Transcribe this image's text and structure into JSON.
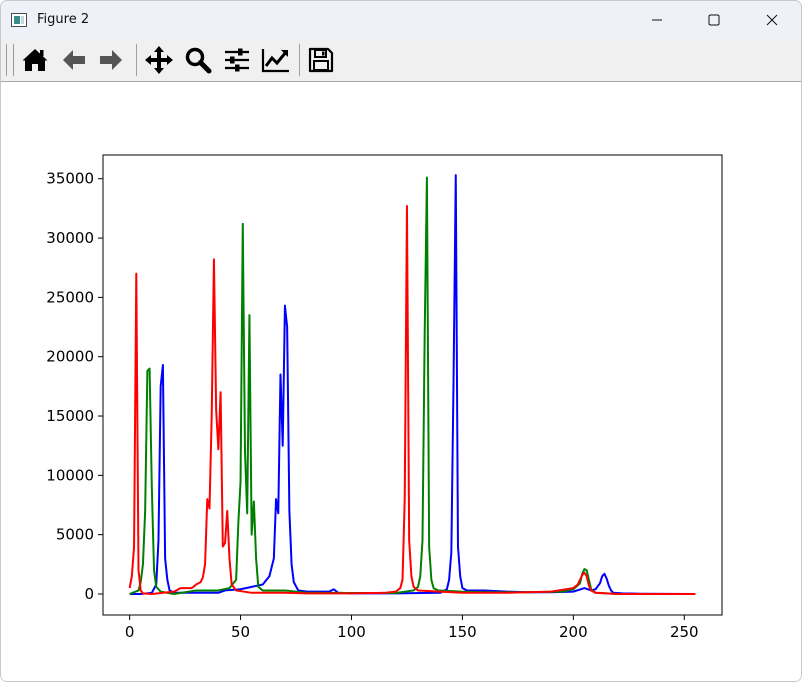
{
  "window": {
    "title": "Figure 2",
    "app_icon": "figure-window-icon",
    "controls": [
      "minimize-icon",
      "maximize-icon",
      "close-icon"
    ]
  },
  "toolbar": {
    "buttons": [
      {
        "name": "home",
        "icon": "home-icon"
      },
      {
        "name": "back",
        "icon": "arrow-left-icon"
      },
      {
        "name": "forward",
        "icon": "arrow-right-icon"
      },
      {
        "name": "pan",
        "icon": "move-icon"
      },
      {
        "name": "zoom",
        "icon": "zoom-icon"
      },
      {
        "name": "configure-subplots",
        "icon": "sliders-icon"
      },
      {
        "name": "edit-axis",
        "icon": "line-chart-icon"
      },
      {
        "name": "save",
        "icon": "floppy-disk-icon"
      }
    ]
  },
  "chart_data": {
    "type": "line",
    "title": "",
    "xlabel": "",
    "ylabel": "",
    "xlim": [
      -12,
      267
    ],
    "ylim": [
      -1770,
      37000
    ],
    "xticks": [
      0,
      50,
      100,
      150,
      200,
      250
    ],
    "yticks": [
      0,
      5000,
      10000,
      15000,
      20000,
      25000,
      30000,
      35000
    ],
    "grid": false,
    "legend": "none",
    "series": [
      {
        "color": "#0000ff",
        "points": [
          [
            0,
            0
          ],
          [
            5,
            0
          ],
          [
            10,
            100
          ],
          [
            12,
            800
          ],
          [
            13,
            4500
          ],
          [
            14,
            17500
          ],
          [
            15,
            19300
          ],
          [
            16,
            3000
          ],
          [
            17,
            1200
          ],
          [
            18,
            300
          ],
          [
            20,
            100
          ],
          [
            30,
            100
          ],
          [
            40,
            100
          ],
          [
            43,
            300
          ],
          [
            50,
            400
          ],
          [
            55,
            600
          ],
          [
            60,
            800
          ],
          [
            63,
            1500
          ],
          [
            65,
            3000
          ],
          [
            66,
            8000
          ],
          [
            67,
            6800
          ],
          [
            68,
            18500
          ],
          [
            69,
            12500
          ],
          [
            70,
            24300
          ],
          [
            71,
            22500
          ],
          [
            72,
            7000
          ],
          [
            73,
            2500
          ],
          [
            74,
            1000
          ],
          [
            76,
            300
          ],
          [
            80,
            200
          ],
          [
            90,
            200
          ],
          [
            92,
            400
          ],
          [
            94,
            100
          ],
          [
            100,
            50
          ],
          [
            120,
            50
          ],
          [
            140,
            100
          ],
          [
            143,
            400
          ],
          [
            144,
            1200
          ],
          [
            145,
            3500
          ],
          [
            146,
            18000
          ],
          [
            147,
            35300
          ],
          [
            148,
            4000
          ],
          [
            149,
            1500
          ],
          [
            150,
            500
          ],
          [
            152,
            300
          ],
          [
            160,
            300
          ],
          [
            170,
            200
          ],
          [
            180,
            150
          ],
          [
            190,
            150
          ],
          [
            200,
            200
          ],
          [
            205,
            500
          ],
          [
            208,
            300
          ],
          [
            210,
            400
          ],
          [
            212,
            900
          ],
          [
            213,
            1500
          ],
          [
            214,
            1700
          ],
          [
            215,
            1300
          ],
          [
            216,
            700
          ],
          [
            217,
            300
          ],
          [
            218,
            100
          ],
          [
            222,
            50
          ],
          [
            230,
            20
          ],
          [
            255,
            0
          ]
        ]
      },
      {
        "color": "#008000",
        "points": [
          [
            0,
            0
          ],
          [
            4,
            300
          ],
          [
            5,
            1000
          ],
          [
            6,
            2500
          ],
          [
            7,
            7000
          ],
          [
            8,
            18800
          ],
          [
            9,
            19000
          ],
          [
            10,
            9000
          ],
          [
            11,
            2000
          ],
          [
            12,
            600
          ],
          [
            14,
            200
          ],
          [
            20,
            0
          ],
          [
            30,
            300
          ],
          [
            40,
            300
          ],
          [
            45,
            500
          ],
          [
            48,
            1200
          ],
          [
            49,
            6000
          ],
          [
            50,
            9500
          ],
          [
            51,
            31200
          ],
          [
            52,
            12000
          ],
          [
            53,
            6800
          ],
          [
            54,
            23500
          ],
          [
            55,
            5000
          ],
          [
            56,
            7800
          ],
          [
            57,
            3000
          ],
          [
            58,
            600
          ],
          [
            60,
            300
          ],
          [
            70,
            300
          ],
          [
            80,
            100
          ],
          [
            100,
            80
          ],
          [
            120,
            80
          ],
          [
            128,
            300
          ],
          [
            130,
            600
          ],
          [
            131,
            1500
          ],
          [
            132,
            4500
          ],
          [
            133,
            22000
          ],
          [
            134,
            35100
          ],
          [
            135,
            4000
          ],
          [
            136,
            1200
          ],
          [
            137,
            500
          ],
          [
            139,
            300
          ],
          [
            150,
            200
          ],
          [
            160,
            150
          ],
          [
            180,
            150
          ],
          [
            195,
            200
          ],
          [
            200,
            400
          ],
          [
            203,
            900
          ],
          [
            204,
            1700
          ],
          [
            205,
            2100
          ],
          [
            206,
            2000
          ],
          [
            207,
            1200
          ],
          [
            208,
            400
          ],
          [
            210,
            100
          ],
          [
            220,
            0
          ],
          [
            255,
            0
          ]
        ]
      },
      {
        "color": "#ff0000",
        "points": [
          [
            0,
            500
          ],
          [
            1,
            1500
          ],
          [
            2,
            4000
          ],
          [
            3,
            27000
          ],
          [
            4,
            2000
          ],
          [
            5,
            300
          ],
          [
            6,
            50
          ],
          [
            10,
            0
          ],
          [
            20,
            200
          ],
          [
            23,
            500
          ],
          [
            28,
            500
          ],
          [
            30,
            800
          ],
          [
            32,
            1000
          ],
          [
            33,
            1400
          ],
          [
            34,
            2500
          ],
          [
            35,
            8000
          ],
          [
            36,
            7200
          ],
          [
            37,
            15000
          ],
          [
            38,
            28200
          ],
          [
            39,
            15500
          ],
          [
            40,
            12200
          ],
          [
            41,
            17000
          ],
          [
            42,
            4000
          ],
          [
            43,
            4300
          ],
          [
            44,
            7000
          ],
          [
            45,
            3000
          ],
          [
            46,
            800
          ],
          [
            48,
            300
          ],
          [
            55,
            100
          ],
          [
            65,
            100
          ],
          [
            70,
            100
          ],
          [
            80,
            50
          ],
          [
            100,
            50
          ],
          [
            115,
            100
          ],
          [
            120,
            200
          ],
          [
            122,
            500
          ],
          [
            123,
            1200
          ],
          [
            124,
            8000
          ],
          [
            125,
            32700
          ],
          [
            126,
            4500
          ],
          [
            127,
            1500
          ],
          [
            128,
            600
          ],
          [
            130,
            300
          ],
          [
            140,
            200
          ],
          [
            150,
            100
          ],
          [
            170,
            100
          ],
          [
            190,
            200
          ],
          [
            200,
            500
          ],
          [
            202,
            800
          ],
          [
            203,
            1200
          ],
          [
            204,
            1600
          ],
          [
            205,
            1800
          ],
          [
            206,
            1500
          ],
          [
            207,
            700
          ],
          [
            208,
            300
          ],
          [
            210,
            100
          ],
          [
            220,
            0
          ],
          [
            255,
            0
          ]
        ]
      }
    ]
  }
}
